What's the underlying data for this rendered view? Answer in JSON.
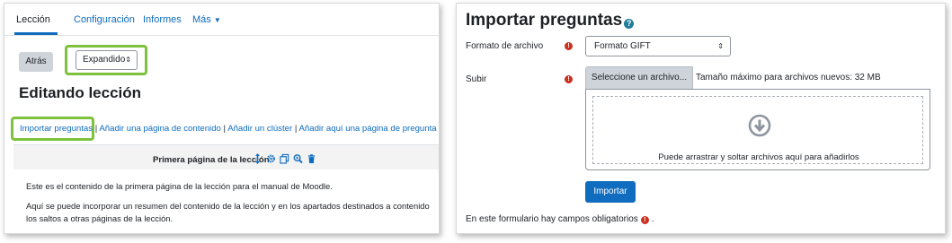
{
  "left_panel": {
    "tabs": [
      {
        "label": "Lección"
      },
      {
        "label": "Configuración"
      },
      {
        "label": "Informes"
      },
      {
        "label": "Más"
      }
    ],
    "back_label": "Atrás",
    "view_select_value": "Expandido",
    "heading": "Editando lección",
    "action_links": [
      {
        "label": "Importar preguntas"
      },
      {
        "label": "Añadir una página de contenido"
      },
      {
        "label": "Añadir un clúster"
      },
      {
        "label": "Añadir aquí una página de pregunta"
      }
    ],
    "separator": "|",
    "page": {
      "title": "Primera página de la lección",
      "paragraphs": [
        "Este es el contenido de la primera página de la lección para el manual de Moodle.",
        "Aquí se puede incorporar un resumen del contenido de la lección y en los apartados destinados a contenido los saltos a otras páginas de la lección."
      ],
      "icons": [
        "move-icon",
        "gear-icon",
        "copy-icon",
        "zoom-icon",
        "trash-icon"
      ]
    },
    "highlight_color": "#7dc13c"
  },
  "right_panel": {
    "heading": "Importar preguntas",
    "format_label": "Formato de archivo",
    "format_value": "Formato GIFT",
    "upload_label": "Subir",
    "choose_file_label": "Seleccione un archivo...",
    "max_size_text": "Tamaño máximo para archivos nuevos: 32 MB",
    "drop_text": "Puede arrastrar y soltar archivos aquí para añadirlos",
    "import_label": "Importar",
    "required_note": "En este formulario hay campos obligatorios",
    "required_note_end": ".",
    "required_mark": "!",
    "accent_color": "#0f6cbf",
    "required_color": "#ca3120"
  }
}
